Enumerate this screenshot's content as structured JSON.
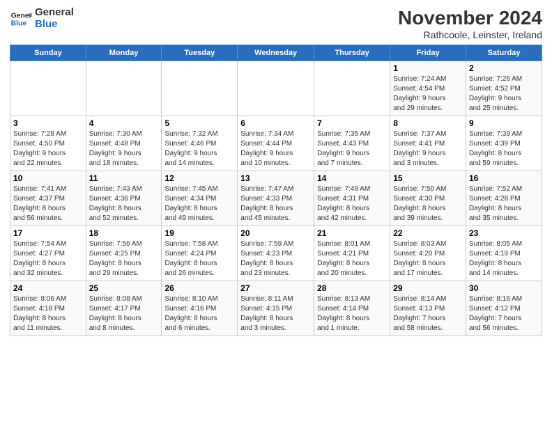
{
  "logo": {
    "line1": "General",
    "line2": "Blue"
  },
  "title": "November 2024",
  "subtitle": "Rathcoole, Leinster, Ireland",
  "days_of_week": [
    "Sunday",
    "Monday",
    "Tuesday",
    "Wednesday",
    "Thursday",
    "Friday",
    "Saturday"
  ],
  "weeks": [
    [
      {
        "day": "",
        "info": ""
      },
      {
        "day": "",
        "info": ""
      },
      {
        "day": "",
        "info": ""
      },
      {
        "day": "",
        "info": ""
      },
      {
        "day": "",
        "info": ""
      },
      {
        "day": "1",
        "info": "Sunrise: 7:24 AM\nSunset: 4:54 PM\nDaylight: 9 hours\nand 29 minutes."
      },
      {
        "day": "2",
        "info": "Sunrise: 7:26 AM\nSunset: 4:52 PM\nDaylight: 9 hours\nand 25 minutes."
      }
    ],
    [
      {
        "day": "3",
        "info": "Sunrise: 7:28 AM\nSunset: 4:50 PM\nDaylight: 9 hours\nand 22 minutes."
      },
      {
        "day": "4",
        "info": "Sunrise: 7:30 AM\nSunset: 4:48 PM\nDaylight: 9 hours\nand 18 minutes."
      },
      {
        "day": "5",
        "info": "Sunrise: 7:32 AM\nSunset: 4:46 PM\nDaylight: 9 hours\nand 14 minutes."
      },
      {
        "day": "6",
        "info": "Sunrise: 7:34 AM\nSunset: 4:44 PM\nDaylight: 9 hours\nand 10 minutes."
      },
      {
        "day": "7",
        "info": "Sunrise: 7:35 AM\nSunset: 4:43 PM\nDaylight: 9 hours\nand 7 minutes."
      },
      {
        "day": "8",
        "info": "Sunrise: 7:37 AM\nSunset: 4:41 PM\nDaylight: 9 hours\nand 3 minutes."
      },
      {
        "day": "9",
        "info": "Sunrise: 7:39 AM\nSunset: 4:39 PM\nDaylight: 8 hours\nand 59 minutes."
      }
    ],
    [
      {
        "day": "10",
        "info": "Sunrise: 7:41 AM\nSunset: 4:37 PM\nDaylight: 8 hours\nand 56 minutes."
      },
      {
        "day": "11",
        "info": "Sunrise: 7:43 AM\nSunset: 4:36 PM\nDaylight: 8 hours\nand 52 minutes."
      },
      {
        "day": "12",
        "info": "Sunrise: 7:45 AM\nSunset: 4:34 PM\nDaylight: 8 hours\nand 49 minutes."
      },
      {
        "day": "13",
        "info": "Sunrise: 7:47 AM\nSunset: 4:33 PM\nDaylight: 8 hours\nand 45 minutes."
      },
      {
        "day": "14",
        "info": "Sunrise: 7:49 AM\nSunset: 4:31 PM\nDaylight: 8 hours\nand 42 minutes."
      },
      {
        "day": "15",
        "info": "Sunrise: 7:50 AM\nSunset: 4:30 PM\nDaylight: 8 hours\nand 39 minutes."
      },
      {
        "day": "16",
        "info": "Sunrise: 7:52 AM\nSunset: 4:28 PM\nDaylight: 8 hours\nand 35 minutes."
      }
    ],
    [
      {
        "day": "17",
        "info": "Sunrise: 7:54 AM\nSunset: 4:27 PM\nDaylight: 8 hours\nand 32 minutes."
      },
      {
        "day": "18",
        "info": "Sunrise: 7:56 AM\nSunset: 4:25 PM\nDaylight: 8 hours\nand 29 minutes."
      },
      {
        "day": "19",
        "info": "Sunrise: 7:58 AM\nSunset: 4:24 PM\nDaylight: 8 hours\nand 26 minutes."
      },
      {
        "day": "20",
        "info": "Sunrise: 7:59 AM\nSunset: 4:23 PM\nDaylight: 8 hours\nand 23 minutes."
      },
      {
        "day": "21",
        "info": "Sunrise: 8:01 AM\nSunset: 4:21 PM\nDaylight: 8 hours\nand 20 minutes."
      },
      {
        "day": "22",
        "info": "Sunrise: 8:03 AM\nSunset: 4:20 PM\nDaylight: 8 hours\nand 17 minutes."
      },
      {
        "day": "23",
        "info": "Sunrise: 8:05 AM\nSunset: 4:19 PM\nDaylight: 8 hours\nand 14 minutes."
      }
    ],
    [
      {
        "day": "24",
        "info": "Sunrise: 8:06 AM\nSunset: 4:18 PM\nDaylight: 8 hours\nand 11 minutes."
      },
      {
        "day": "25",
        "info": "Sunrise: 8:08 AM\nSunset: 4:17 PM\nDaylight: 8 hours\nand 8 minutes."
      },
      {
        "day": "26",
        "info": "Sunrise: 8:10 AM\nSunset: 4:16 PM\nDaylight: 8 hours\nand 6 minutes."
      },
      {
        "day": "27",
        "info": "Sunrise: 8:11 AM\nSunset: 4:15 PM\nDaylight: 8 hours\nand 3 minutes."
      },
      {
        "day": "28",
        "info": "Sunrise: 8:13 AM\nSunset: 4:14 PM\nDaylight: 8 hours\nand 1 minute."
      },
      {
        "day": "29",
        "info": "Sunrise: 8:14 AM\nSunset: 4:13 PM\nDaylight: 7 hours\nand 58 minutes."
      },
      {
        "day": "30",
        "info": "Sunrise: 8:16 AM\nSunset: 4:12 PM\nDaylight: 7 hours\nand 56 minutes."
      }
    ]
  ]
}
